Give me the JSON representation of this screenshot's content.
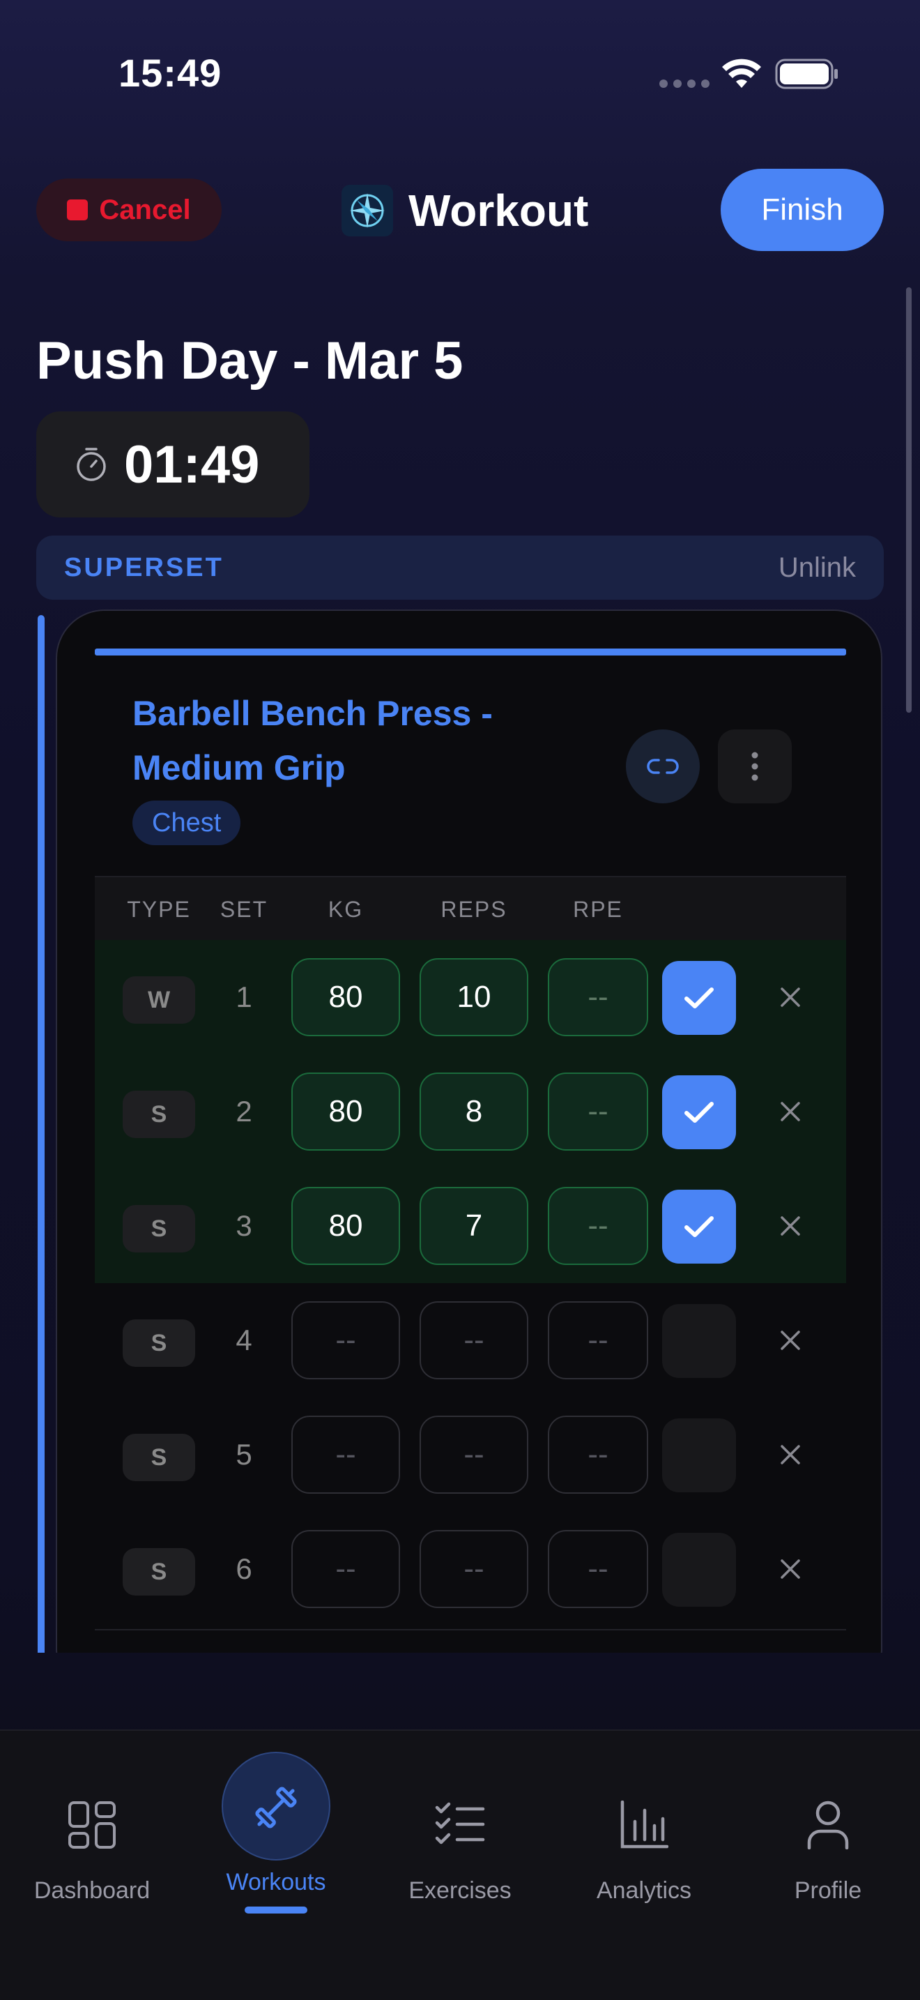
{
  "status_bar": {
    "time": "15:49",
    "icons": [
      "signal-dots-icon",
      "wifi-icon",
      "battery-icon"
    ]
  },
  "header": {
    "cancel_label": "Cancel",
    "title": "Workout",
    "finish_label": "Finish",
    "app_icon": "compass-icon"
  },
  "workout": {
    "name": "Push Day - Mar 5",
    "timer": "01:49"
  },
  "superset": {
    "label": "SUPERSET",
    "unlink_label": "Unlink"
  },
  "exercise": {
    "name_line1": "Barbell Bench Press -",
    "name_line2": "Medium Grip",
    "muscle": "Chest",
    "columns": [
      "TYPE",
      "SET",
      "KG",
      "REPS",
      "RPE"
    ],
    "sets": [
      {
        "type": "W",
        "set": "1",
        "kg": "80",
        "reps": "10",
        "rpe": "--",
        "completed": true
      },
      {
        "type": "S",
        "set": "2",
        "kg": "80",
        "reps": "8",
        "rpe": "--",
        "completed": true
      },
      {
        "type": "S",
        "set": "3",
        "kg": "80",
        "reps": "7",
        "rpe": "--",
        "completed": true
      },
      {
        "type": "S",
        "set": "4",
        "kg": "--",
        "reps": "--",
        "rpe": "--",
        "completed": false
      },
      {
        "type": "S",
        "set": "5",
        "kg": "--",
        "reps": "--",
        "rpe": "--",
        "completed": false
      },
      {
        "type": "S",
        "set": "6",
        "kg": "--",
        "reps": "--",
        "rpe": "--",
        "completed": false
      }
    ]
  },
  "tabbar": {
    "items": [
      {
        "label": "Dashboard",
        "icon": "grid-icon"
      },
      {
        "label": "Workouts",
        "icon": "dumbbell-icon",
        "active": true
      },
      {
        "label": "Exercises",
        "icon": "checklist-icon"
      },
      {
        "label": "Analytics",
        "icon": "bar-chart-icon"
      },
      {
        "label": "Profile",
        "icon": "person-icon"
      }
    ]
  },
  "colors": {
    "accent": "#4a84f5",
    "danger": "#e8192f",
    "done_bg": "#0c1c13",
    "done_border": "#1b6b3c"
  }
}
